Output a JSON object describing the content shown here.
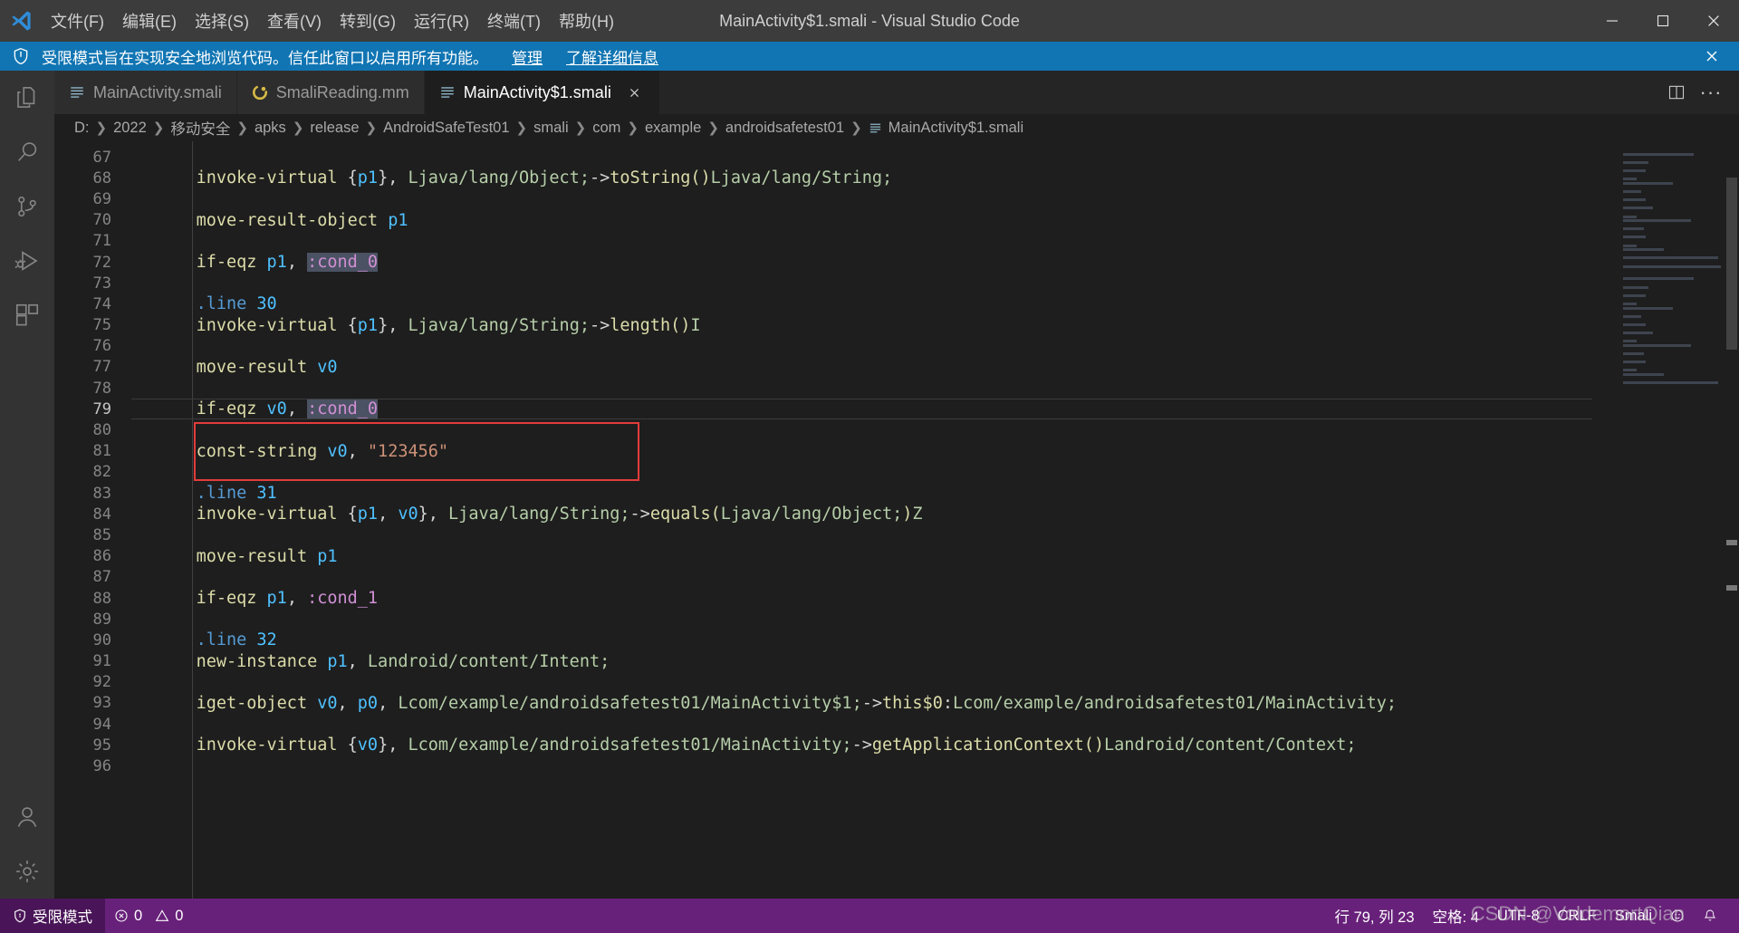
{
  "window": {
    "title": "MainActivity$1.smali - Visual Studio Code",
    "logo_icon": "vscode-logo-icon",
    "minimize_label": "minimize",
    "maximize_label": "maximize",
    "close_label": "close"
  },
  "menubar": {
    "items": [
      {
        "label": "文件(F)",
        "name": "menu-file"
      },
      {
        "label": "编辑(E)",
        "name": "menu-edit"
      },
      {
        "label": "选择(S)",
        "name": "menu-selection"
      },
      {
        "label": "查看(V)",
        "name": "menu-view"
      },
      {
        "label": "转到(G)",
        "name": "menu-go"
      },
      {
        "label": "运行(R)",
        "name": "menu-run"
      },
      {
        "label": "终端(T)",
        "name": "menu-terminal"
      },
      {
        "label": "帮助(H)",
        "name": "menu-help"
      }
    ]
  },
  "banner": {
    "icon": "shield-icon",
    "message": "受限模式旨在实现安全地浏览代码。信任此窗口以启用所有功能。",
    "link_manage": "管理",
    "link_learn": "了解详细信息",
    "close_icon": "close-icon",
    "background": "#1175b3"
  },
  "activitybar": {
    "items": [
      {
        "name": "explorer-icon",
        "label": "资源管理器"
      },
      {
        "name": "search-icon",
        "label": "搜索"
      },
      {
        "name": "source-control-icon",
        "label": "源代码管理"
      },
      {
        "name": "run-debug-icon",
        "label": "运行和调试"
      },
      {
        "name": "extensions-icon",
        "label": "扩展"
      }
    ],
    "bottom": [
      {
        "name": "account-icon",
        "label": "账户"
      },
      {
        "name": "gear-icon",
        "label": "管理"
      }
    ]
  },
  "tabs": [
    {
      "label": "MainActivity.smali",
      "icon": "smali-file-icon",
      "active": false,
      "dirty": false
    },
    {
      "label": "SmaliReading.mm",
      "icon": "mindmap-file-icon",
      "active": false,
      "dirty": false
    },
    {
      "label": "MainActivity$1.smali",
      "icon": "smali-file-icon",
      "active": true,
      "dirty": false
    }
  ],
  "tab_actions": [
    {
      "name": "split-editor-button",
      "label": "拆分编辑器"
    },
    {
      "name": "more-actions-button",
      "label": "更多操作..."
    }
  ],
  "breadcrumbs": [
    "D:",
    "2022",
    "移动安全",
    "apks",
    "release",
    "AndroidSafeTest01",
    "smali",
    "com",
    "example",
    "androidsafetest01",
    "MainActivity$1.smali"
  ],
  "editor": {
    "first_line": 67,
    "current_line": 79,
    "annotation": {
      "color": "#e33b3b",
      "target_line": 81
    },
    "lines": [
      {
        "n": 67,
        "tokens": []
      },
      {
        "n": 68,
        "tokens": [
          {
            "t": "    ",
            "c": "tk-pun"
          },
          {
            "t": "invoke-virtual",
            "c": "tk-op"
          },
          {
            "t": " {",
            "c": "tk-pun"
          },
          {
            "t": "p1",
            "c": "tk-reg"
          },
          {
            "t": "}, ",
            "c": "tk-pun"
          },
          {
            "t": "Ljava/lang/Object;",
            "c": "tk-type"
          },
          {
            "t": "->",
            "c": "tk-pun"
          },
          {
            "t": "toString()",
            "c": "tk-mth"
          },
          {
            "t": "Ljava/lang/String;",
            "c": "tk-type"
          }
        ]
      },
      {
        "n": 69,
        "tokens": []
      },
      {
        "n": 70,
        "tokens": [
          {
            "t": "    ",
            "c": "tk-pun"
          },
          {
            "t": "move-result-object",
            "c": "tk-op"
          },
          {
            "t": " ",
            "c": "tk-pun"
          },
          {
            "t": "p1",
            "c": "tk-reg"
          }
        ]
      },
      {
        "n": 71,
        "tokens": []
      },
      {
        "n": 72,
        "tokens": [
          {
            "t": "    ",
            "c": "tk-pun"
          },
          {
            "t": "if-eqz",
            "c": "tk-op"
          },
          {
            "t": " ",
            "c": "tk-pun"
          },
          {
            "t": "p1",
            "c": "tk-reg"
          },
          {
            "t": ", ",
            "c": "tk-pun"
          },
          {
            "t": ":cond_0",
            "c": "tk-lbl hl-occ"
          }
        ]
      },
      {
        "n": 73,
        "tokens": []
      },
      {
        "n": 74,
        "tokens": [
          {
            "t": "    ",
            "c": "tk-pun"
          },
          {
            "t": ".line",
            "c": "tk-dir"
          },
          {
            "t": " ",
            "c": "tk-pun"
          },
          {
            "t": "30",
            "c": "tk-num"
          }
        ]
      },
      {
        "n": 75,
        "tokens": [
          {
            "t": "    ",
            "c": "tk-pun"
          },
          {
            "t": "invoke-virtual",
            "c": "tk-op"
          },
          {
            "t": " {",
            "c": "tk-pun"
          },
          {
            "t": "p1",
            "c": "tk-reg"
          },
          {
            "t": "}, ",
            "c": "tk-pun"
          },
          {
            "t": "Ljava/lang/String;",
            "c": "tk-type"
          },
          {
            "t": "->",
            "c": "tk-pun"
          },
          {
            "t": "length()",
            "c": "tk-mth"
          },
          {
            "t": "I",
            "c": "tk-type"
          }
        ]
      },
      {
        "n": 76,
        "tokens": []
      },
      {
        "n": 77,
        "tokens": [
          {
            "t": "    ",
            "c": "tk-pun"
          },
          {
            "t": "move-result",
            "c": "tk-op"
          },
          {
            "t": " ",
            "c": "tk-pun"
          },
          {
            "t": "v0",
            "c": "tk-reg"
          }
        ]
      },
      {
        "n": 78,
        "tokens": []
      },
      {
        "n": 79,
        "tokens": [
          {
            "t": "    ",
            "c": "tk-pun"
          },
          {
            "t": "if-eqz",
            "c": "tk-op"
          },
          {
            "t": " ",
            "c": "tk-pun"
          },
          {
            "t": "v0",
            "c": "tk-reg"
          },
          {
            "t": ", ",
            "c": "tk-pun"
          },
          {
            "t": ":cond_0",
            "c": "tk-lbl hl-occ"
          }
        ]
      },
      {
        "n": 80,
        "tokens": []
      },
      {
        "n": 81,
        "tokens": [
          {
            "t": "    ",
            "c": "tk-pun"
          },
          {
            "t": "const-string",
            "c": "tk-op"
          },
          {
            "t": " ",
            "c": "tk-pun"
          },
          {
            "t": "v0",
            "c": "tk-reg"
          },
          {
            "t": ", ",
            "c": "tk-pun"
          },
          {
            "t": "\"123456\"",
            "c": "tk-str"
          }
        ]
      },
      {
        "n": 82,
        "tokens": []
      },
      {
        "n": 83,
        "tokens": [
          {
            "t": "    ",
            "c": "tk-pun"
          },
          {
            "t": ".line",
            "c": "tk-dir"
          },
          {
            "t": " ",
            "c": "tk-pun"
          },
          {
            "t": "31",
            "c": "tk-num"
          }
        ]
      },
      {
        "n": 84,
        "tokens": [
          {
            "t": "    ",
            "c": "tk-pun"
          },
          {
            "t": "invoke-virtual",
            "c": "tk-op"
          },
          {
            "t": " {",
            "c": "tk-pun"
          },
          {
            "t": "p1",
            "c": "tk-reg"
          },
          {
            "t": ", ",
            "c": "tk-pun"
          },
          {
            "t": "v0",
            "c": "tk-reg"
          },
          {
            "t": "}, ",
            "c": "tk-pun"
          },
          {
            "t": "Ljava/lang/String;",
            "c": "tk-type"
          },
          {
            "t": "->",
            "c": "tk-pun"
          },
          {
            "t": "equals(",
            "c": "tk-mth"
          },
          {
            "t": "Ljava/lang/Object;",
            "c": "tk-type"
          },
          {
            "t": ")",
            "c": "tk-mth"
          },
          {
            "t": "Z",
            "c": "tk-type"
          }
        ]
      },
      {
        "n": 85,
        "tokens": []
      },
      {
        "n": 86,
        "tokens": [
          {
            "t": "    ",
            "c": "tk-pun"
          },
          {
            "t": "move-result",
            "c": "tk-op"
          },
          {
            "t": " ",
            "c": "tk-pun"
          },
          {
            "t": "p1",
            "c": "tk-reg"
          }
        ]
      },
      {
        "n": 87,
        "tokens": []
      },
      {
        "n": 88,
        "tokens": [
          {
            "t": "    ",
            "c": "tk-pun"
          },
          {
            "t": "if-eqz",
            "c": "tk-op"
          },
          {
            "t": " ",
            "c": "tk-pun"
          },
          {
            "t": "p1",
            "c": "tk-reg"
          },
          {
            "t": ", ",
            "c": "tk-pun"
          },
          {
            "t": ":cond_1",
            "c": "tk-lbl"
          }
        ]
      },
      {
        "n": 89,
        "tokens": []
      },
      {
        "n": 90,
        "tokens": [
          {
            "t": "    ",
            "c": "tk-pun"
          },
          {
            "t": ".line",
            "c": "tk-dir"
          },
          {
            "t": " ",
            "c": "tk-pun"
          },
          {
            "t": "32",
            "c": "tk-num"
          }
        ]
      },
      {
        "n": 91,
        "tokens": [
          {
            "t": "    ",
            "c": "tk-pun"
          },
          {
            "t": "new-instance",
            "c": "tk-op"
          },
          {
            "t": " ",
            "c": "tk-pun"
          },
          {
            "t": "p1",
            "c": "tk-reg"
          },
          {
            "t": ", ",
            "c": "tk-pun"
          },
          {
            "t": "Landroid/content/Intent;",
            "c": "tk-type"
          }
        ]
      },
      {
        "n": 92,
        "tokens": []
      },
      {
        "n": 93,
        "tokens": [
          {
            "t": "    ",
            "c": "tk-pun"
          },
          {
            "t": "iget-object",
            "c": "tk-op"
          },
          {
            "t": " ",
            "c": "tk-pun"
          },
          {
            "t": "v0",
            "c": "tk-reg"
          },
          {
            "t": ", ",
            "c": "tk-pun"
          },
          {
            "t": "p0",
            "c": "tk-reg"
          },
          {
            "t": ", ",
            "c": "tk-pun"
          },
          {
            "t": "Lcom/example/androidsafetest01/MainActivity$1;",
            "c": "tk-type"
          },
          {
            "t": "->",
            "c": "tk-pun"
          },
          {
            "t": "this$0",
            "c": "tk-mth"
          },
          {
            "t": ":",
            "c": "tk-pun"
          },
          {
            "t": "Lcom/example/androidsafetest01/MainActivity;",
            "c": "tk-type"
          }
        ]
      },
      {
        "n": 94,
        "tokens": []
      },
      {
        "n": 95,
        "tokens": [
          {
            "t": "    ",
            "c": "tk-pun"
          },
          {
            "t": "invoke-virtual",
            "c": "tk-op"
          },
          {
            "t": " {",
            "c": "tk-pun"
          },
          {
            "t": "v0",
            "c": "tk-reg"
          },
          {
            "t": "}, ",
            "c": "tk-pun"
          },
          {
            "t": "Lcom/example/androidsafetest01/MainActivity;",
            "c": "tk-type"
          },
          {
            "t": "->",
            "c": "tk-pun"
          },
          {
            "t": "getApplicationContext()",
            "c": "tk-mth"
          },
          {
            "t": "Landroid/content/Context;",
            "c": "tk-type"
          }
        ]
      },
      {
        "n": 96,
        "tokens": []
      }
    ]
  },
  "statusbar": {
    "trust_icon": "shield-icon",
    "trust_label": "受限模式",
    "error_icon": "error-icon",
    "error_count": "0",
    "warning_icon": "warning-icon",
    "warning_count": "0",
    "position": "行 79, 列 23",
    "indent": "空格: 4",
    "encoding": "UTF-8",
    "eol": "CRLF",
    "language": "Smali",
    "feedback_icon": "smiley-icon",
    "bell_icon": "bell-icon",
    "background": "#68217a"
  },
  "watermark": "CSDN @VoldemortQian"
}
